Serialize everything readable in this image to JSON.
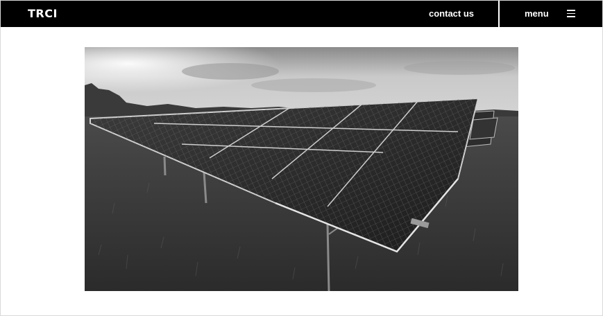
{
  "header": {
    "logo": "TRCI",
    "contact_label": "contact us",
    "menu_label": "menu",
    "menu_icon": "hamburger-icon",
    "background": "#000000",
    "text_color": "#ffffff"
  },
  "hero": {
    "image_subject": "solar-panel-array-photo",
    "palette": "grayscale"
  }
}
